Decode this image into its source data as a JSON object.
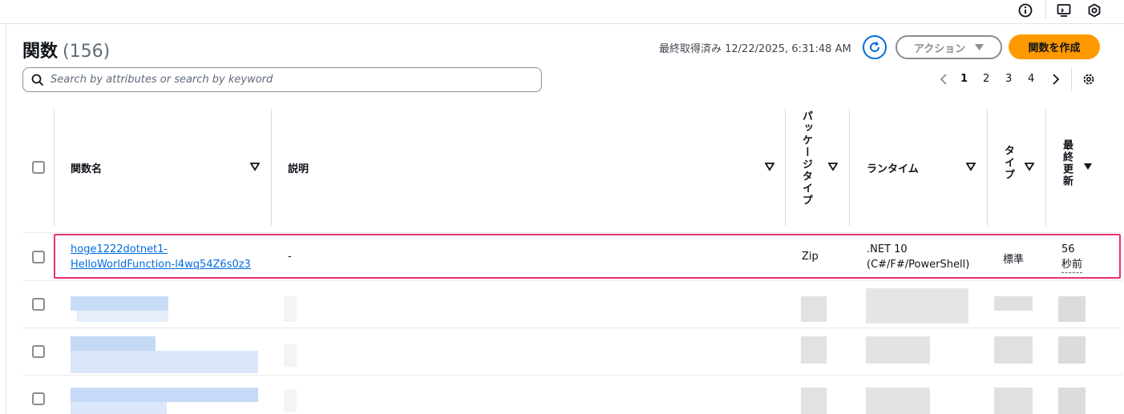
{
  "topbar": {
    "icons": [
      "info-icon",
      "cloudshell-icon",
      "settings-hex-icon"
    ]
  },
  "header": {
    "title": "関数",
    "count": "(156)",
    "last_fetched": "最終取得済み 12/22/2025, 6:31:48 AM",
    "action_label": "アクション",
    "create_label": "関数を作成"
  },
  "search": {
    "placeholder": "Search by attributes or search by keyword",
    "value": ""
  },
  "pagination": {
    "pages": [
      "1",
      "2",
      "3",
      "4"
    ],
    "current": "1"
  },
  "table": {
    "columns": {
      "name": "関数名",
      "description": "説明",
      "package_type": "パッケージタイプ",
      "runtime": "ランタイム",
      "type": "タイプ",
      "last_modified": "最終更新"
    },
    "rows": [
      {
        "name_line1": "hoge1222dotnet1-",
        "name_line2": "HelloWorldFunction-l4wq54Z6s0z3",
        "description": "-",
        "package_type": "Zip",
        "runtime_line1": ".NET 10",
        "runtime_line2": "(C#/F#/PowerShell)",
        "type": "標準",
        "last_modified_line1": "56",
        "last_modified_line2": "秒前"
      }
    ]
  },
  "colors": {
    "link": "#006ce0",
    "primary_button": "#ff9900",
    "highlight_border": "#e8326b",
    "text": "#0f141a"
  }
}
